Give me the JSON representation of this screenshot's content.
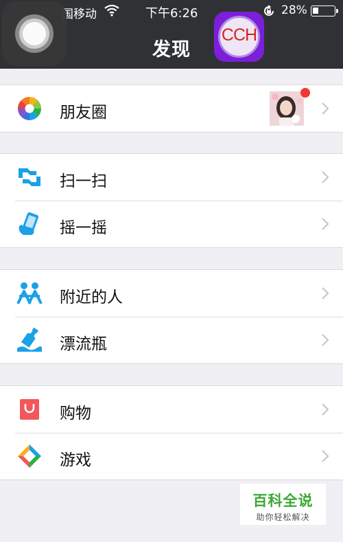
{
  "status_bar": {
    "carrier": "国移动",
    "time": "下午6:26",
    "battery_percent": "28%",
    "battery_level": 0.28
  },
  "nav": {
    "title": "发现"
  },
  "overlays": {
    "assistive_touch": "assistive-touch-icon",
    "app_badge_text": "CCH"
  },
  "moments": {
    "label": "朋友圈",
    "has_unread_dot": true
  },
  "scan": {
    "label": "扫一扫"
  },
  "shake": {
    "label": "摇一摇"
  },
  "nearby": {
    "label": "附近的人"
  },
  "bottle": {
    "label": "漂流瓶"
  },
  "shopping": {
    "label": "购物"
  },
  "games": {
    "label": "游戏"
  },
  "watermark": {
    "title": "百科全说",
    "subtitle": "助你轻松解决"
  },
  "colors": {
    "nav_bg": "#2f3135",
    "page_bg": "#efeff4",
    "accent_blue": "#1aa1e6",
    "badge_red": "#f43530",
    "shopping_red": "#f2575b"
  }
}
